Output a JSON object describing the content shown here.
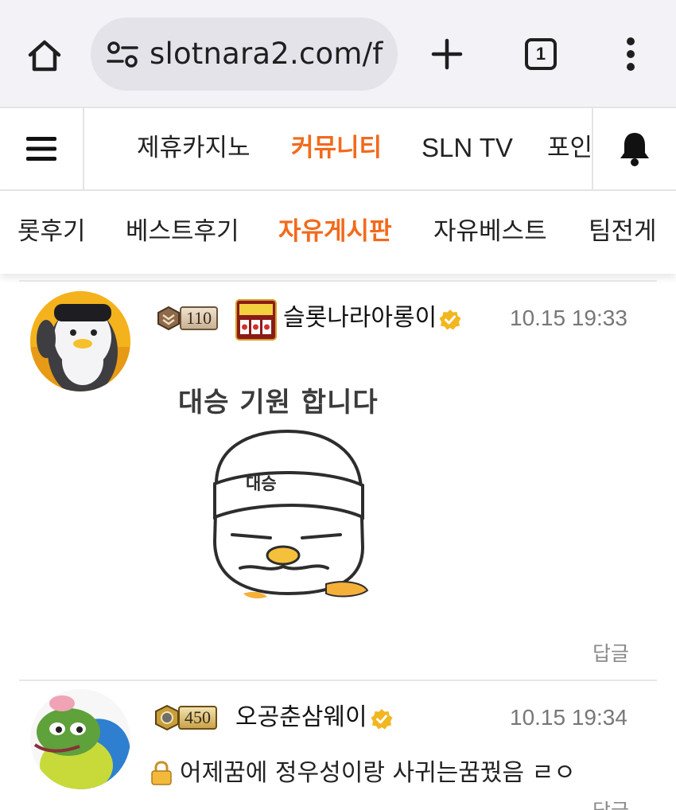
{
  "browser": {
    "url": "slotnara2.com/f",
    "tab_count": "1",
    "icons": [
      "home-icon",
      "site-settings-icon",
      "plus-icon",
      "tab-switcher-icon",
      "more-vert-icon"
    ]
  },
  "site_nav": {
    "items": [
      {
        "label": "제휴카지노"
      },
      {
        "label": "커뮤니티"
      },
      {
        "label": "SLN TV"
      },
      {
        "label": "포인"
      }
    ],
    "active_index": 1,
    "accent_color": "#f26a1b"
  },
  "sub_nav": {
    "items": [
      {
        "label": "롯후기"
      },
      {
        "label": "베스트후기"
      },
      {
        "label": "자유게시판"
      },
      {
        "label": "자유베스트"
      },
      {
        "label": "팀전게"
      }
    ],
    "active_index": 2
  },
  "comments": [
    {
      "level": "110",
      "username": "슬롯나라아롱이",
      "timestamp": "10.15 19:33",
      "sticker_text": "대승 기원 합니다",
      "sticker_headband": "대승",
      "reply_label": "답글"
    },
    {
      "level": "450",
      "username": "오공춘삼웨이",
      "timestamp": "10.15 19:34",
      "text": "어제꿈에 정우성이랑 사귀는꿈꿨음 ㄹㅇ",
      "reply_label": "답글"
    }
  ]
}
